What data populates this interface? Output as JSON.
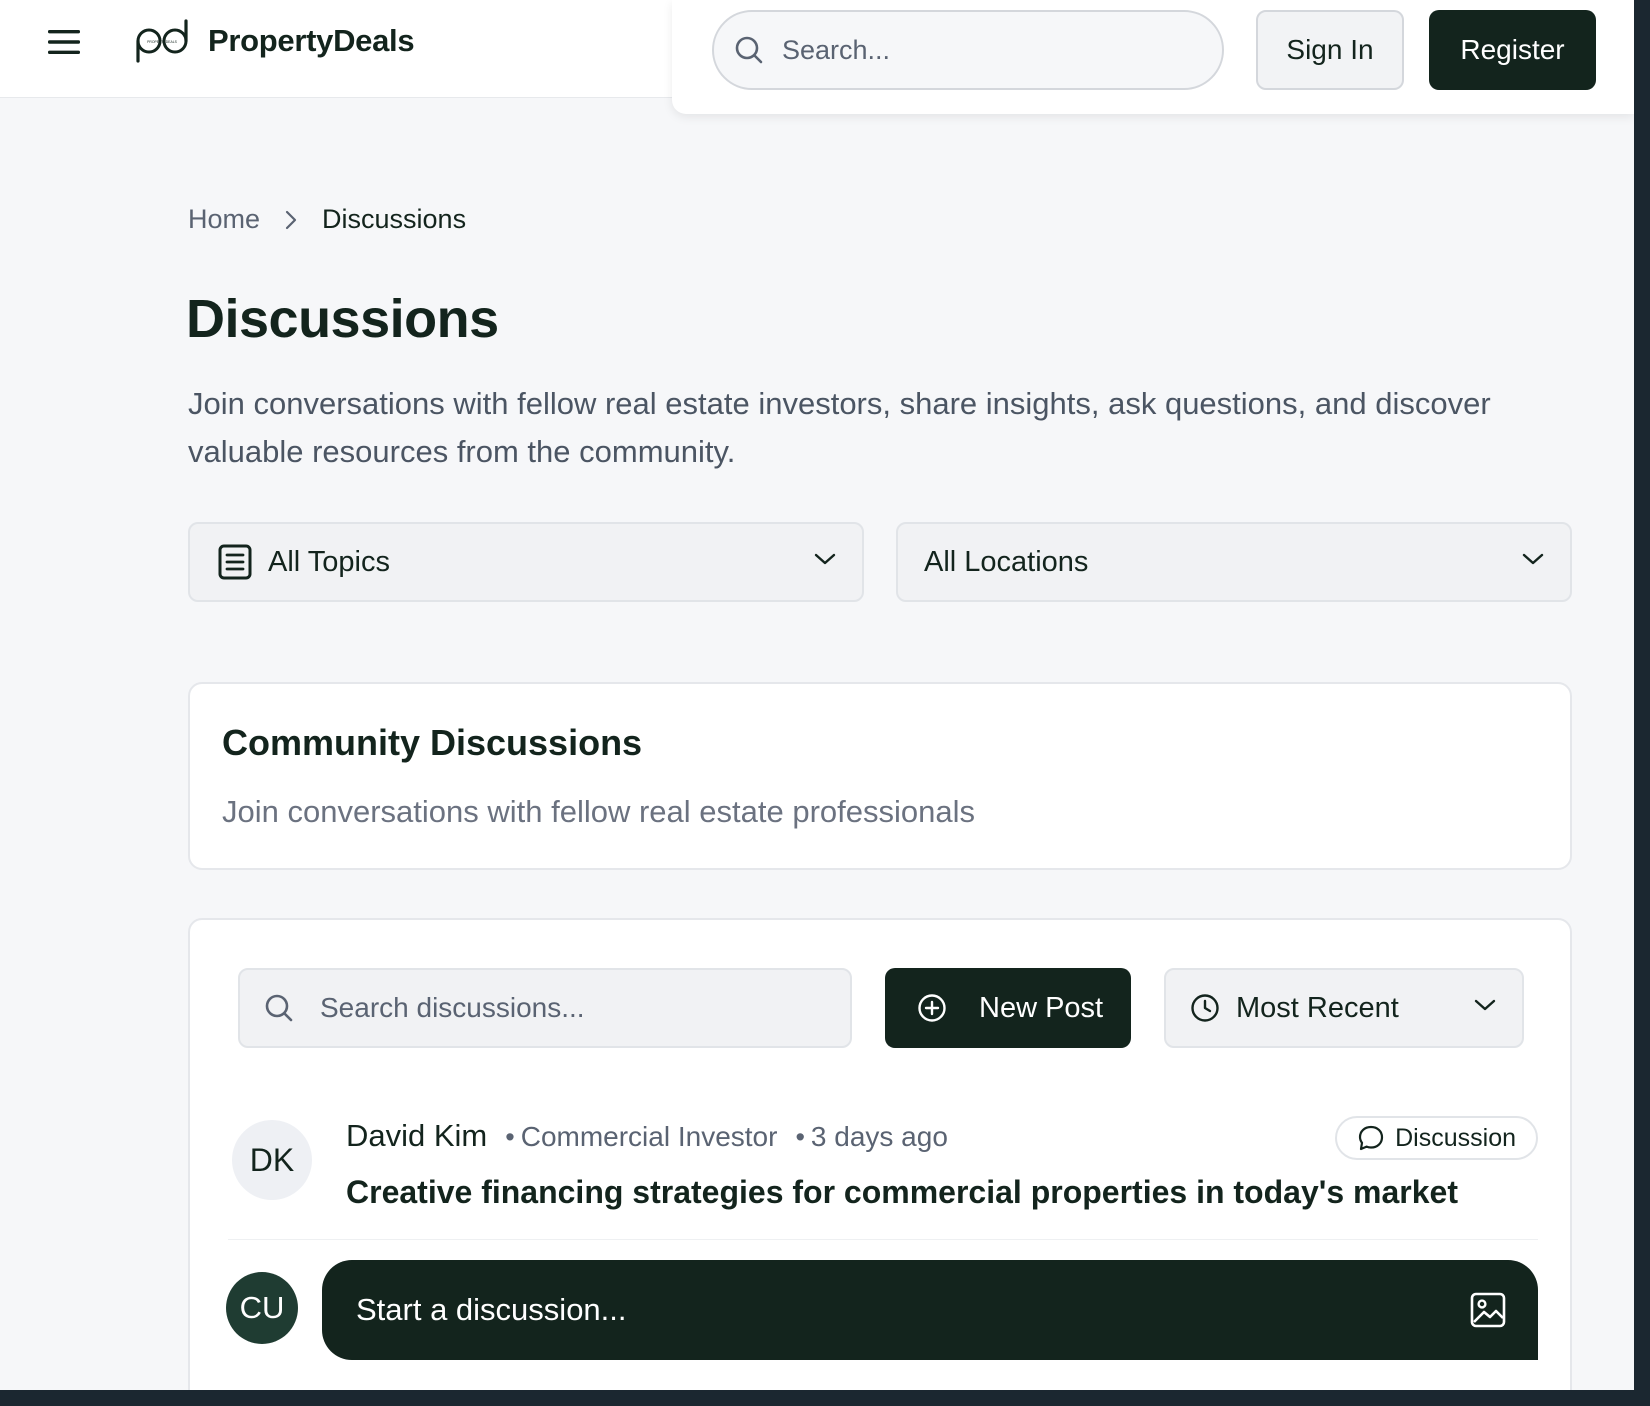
{
  "header": {
    "brand": "PropertyDeals",
    "logo_tagline": "PROPERTYDEALS",
    "search_placeholder": "Search...",
    "sign_in_label": "Sign In",
    "register_label": "Register"
  },
  "breadcrumb": {
    "home": "Home",
    "current": "Discussions"
  },
  "page": {
    "title": "Discussions",
    "description": "Join conversations with fellow real estate investors, share insights, ask questions, and discover valuable resources from the community."
  },
  "filters": {
    "topics": "All Topics",
    "locations": "All Locations"
  },
  "community": {
    "title": "Community Discussions",
    "subtitle": "Join conversations with fellow real estate professionals"
  },
  "feed": {
    "search_placeholder": "Search discussions...",
    "new_post_label": "New Post",
    "sort_label": "Most Recent",
    "posts": [
      {
        "initials": "DK",
        "author": "David Kim",
        "role": "Commercial Investor",
        "time": "3 days ago",
        "badge": "Discussion",
        "title": "Creative financing strategies for commercial properties in today's market"
      }
    ],
    "composer": {
      "initials": "CU",
      "placeholder": "Start a discussion..."
    }
  },
  "colors": {
    "primary": "#13241d",
    "background": "#f6f7f9",
    "muted_text": "#5a6372"
  },
  "icons": {
    "menu": "hamburger-menu-icon",
    "search": "search-icon",
    "breadcrumb_separator": "chevron-right-icon",
    "topics": "document-list-icon",
    "dropdown": "chevron-down-icon",
    "new_post": "plus-circle-icon",
    "sort": "clock-icon",
    "badge": "chat-bubble-icon",
    "composer_image": "image-icon"
  }
}
